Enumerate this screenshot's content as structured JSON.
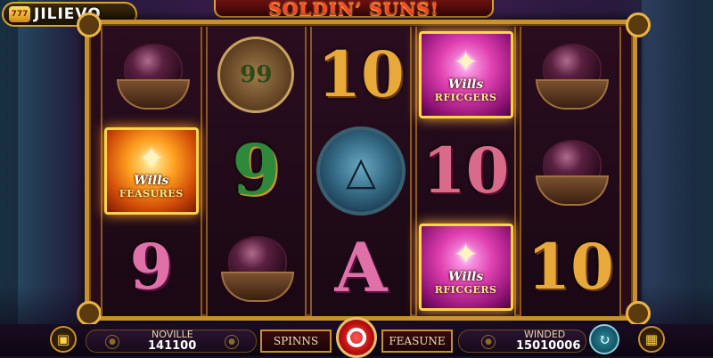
{
  "logo": {
    "text": "JILIEVO",
    "badge": "777"
  },
  "title": "SOLDIN’ SUNS!",
  "reels": [
    [
      {
        "type": "gem-orb"
      },
      {
        "type": "wild-gold",
        "top": "Wills",
        "bottom": "FEASURES"
      },
      {
        "type": "number",
        "value": "9",
        "style": "pink"
      }
    ],
    [
      {
        "type": "emblem",
        "text": "99"
      },
      {
        "type": "number",
        "value": "9",
        "style": "green"
      },
      {
        "type": "gem-orb"
      }
    ],
    [
      {
        "type": "number",
        "value": "10",
        "style": "gold"
      },
      {
        "type": "lion"
      },
      {
        "type": "letter",
        "value": "A"
      }
    ],
    [
      {
        "type": "wild-pink",
        "top": "Wills",
        "bottom": "RFICGERS"
      },
      {
        "type": "number",
        "value": "10",
        "style": "red"
      },
      {
        "type": "wild-pink",
        "top": "Wills",
        "bottom": "RFICGERS"
      }
    ],
    [
      {
        "type": "gem-orb"
      },
      {
        "type": "gem-orb"
      },
      {
        "type": "number",
        "value": "10",
        "style": "gold"
      }
    ]
  ],
  "bottom_bar": {
    "balance_label": "NOVILLE",
    "balance_value": "141100",
    "spins_label": "SPINNS",
    "feature_label": "FEASUNE",
    "win_label": "WINDED",
    "win_value": "15010006",
    "left_icon": "chest-icon",
    "right_icon": "treasure-icon",
    "auto_icon": "auto-spin-icon"
  }
}
